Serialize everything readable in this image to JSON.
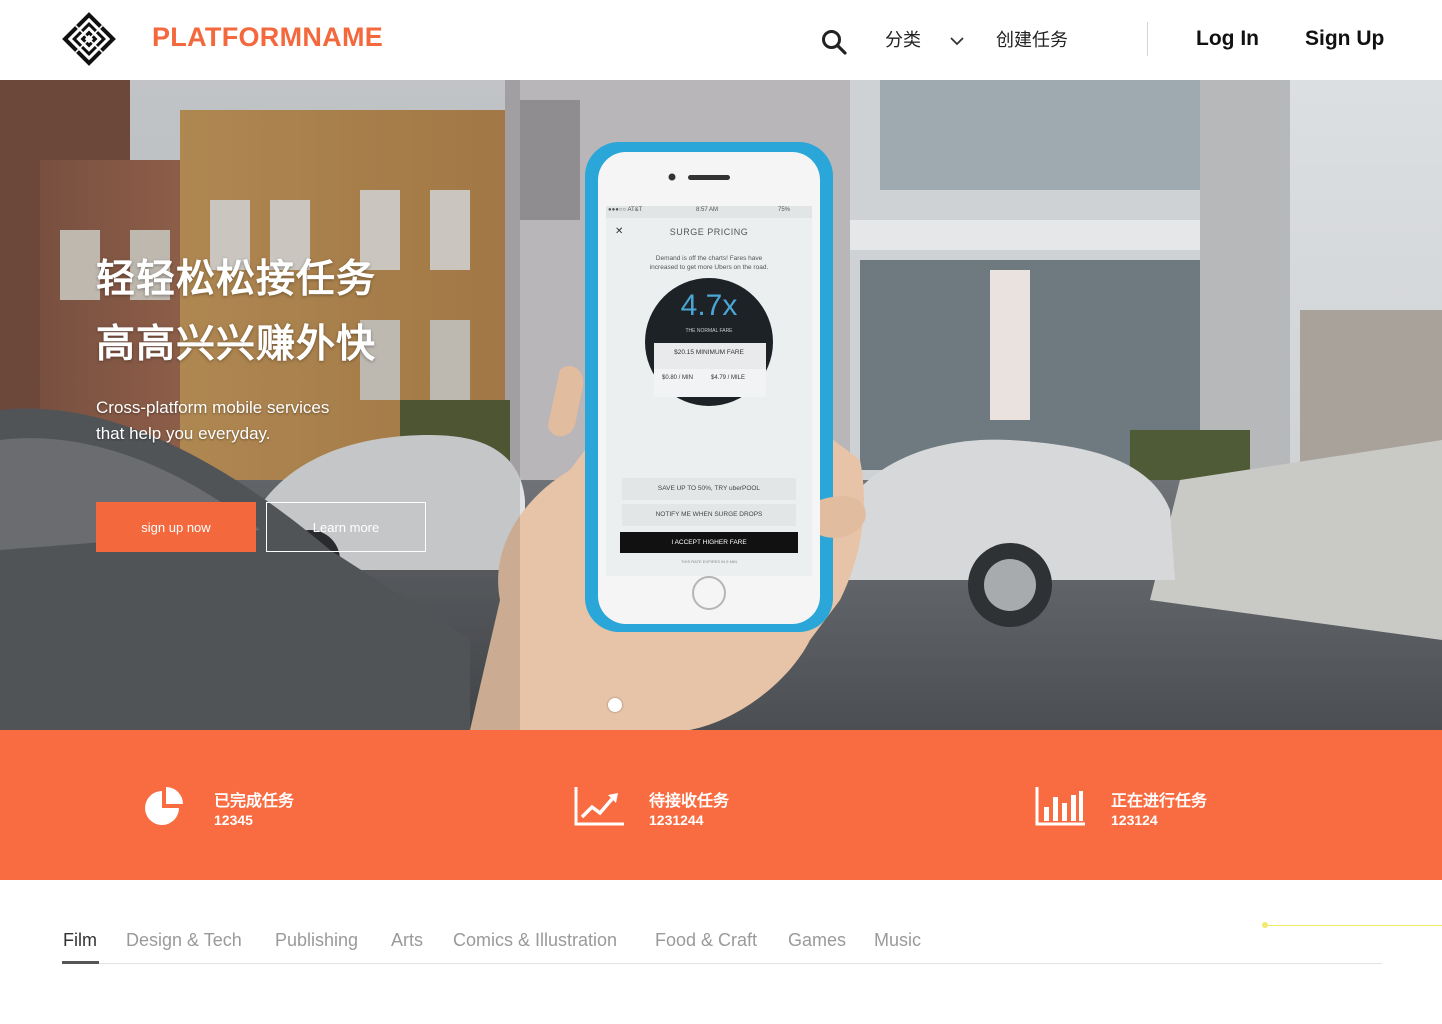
{
  "brand": {
    "name": "PLATFORMNAME",
    "logo_icon": "diamond-lattice-logo",
    "color": "#f4683d"
  },
  "nav": {
    "search_icon": "search-icon",
    "category_label": "分类",
    "category_icon": "chevron-down-icon",
    "create_task_label": "创建任务",
    "login_label": "Log In",
    "signup_label": "Sign Up"
  },
  "hero": {
    "title_line1": "轻轻松松接任务",
    "title_line2": "高高兴兴赚外快",
    "subtitle_line1": "Cross-platform mobile services",
    "subtitle_line2": "that help you everyday.",
    "primary_button": "sign up now",
    "secondary_button": "Learn more",
    "phone_screen": {
      "carrier": "●●●○○ AT&T",
      "time": "8:57 AM",
      "battery": "75%",
      "header": "SURGE PRICING",
      "message_line1": "Demand is off the charts! Fares have",
      "message_line2": "increased to get more Ubers on the road.",
      "multiplier": "4.7x",
      "multiplier_caption": "THE NORMAL FARE",
      "minimum_fare": "$20.15 MINIMUM FARE",
      "per_min": "$0.80 / MIN",
      "per_mile": "$4.79 / MILE",
      "option1": "SAVE UP TO 50%, TRY uberPOOL",
      "option2": "NOTIFY ME WHEN SURGE DROPS",
      "accept_button": "I ACCEPT HIGHER FARE",
      "footnote": "THIS RATE EXPIRES IN 5 MIN"
    }
  },
  "stats": {
    "background": "#f96b40",
    "items": [
      {
        "icon": "pie-chart-icon",
        "label": "已完成任务",
        "value": "12345"
      },
      {
        "icon": "line-chart-icon",
        "label": "待接收任务",
        "value": "1231244"
      },
      {
        "icon": "bar-chart-icon",
        "label": "正在进行任务",
        "value": "123124"
      }
    ]
  },
  "tabs": {
    "active": "Film",
    "items": [
      "Film",
      "Design & Tech",
      "Publishing",
      "Arts",
      "Comics & Illustration",
      "Food & Craft",
      "Games",
      "Music"
    ]
  }
}
